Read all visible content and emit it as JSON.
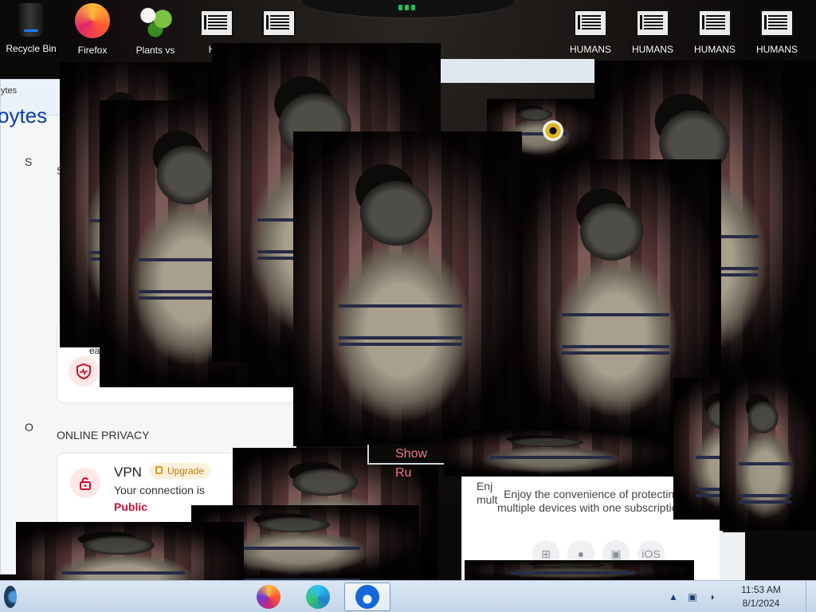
{
  "desktop": {
    "icons_left": [
      {
        "label": "Recycle Bin",
        "icon": "recycle-bin-icon"
      },
      {
        "label": "Firefox",
        "icon": "firefox-icon"
      },
      {
        "label": "Plants vs",
        "icon": "plants-vs-zombies-icon"
      },
      {
        "label": "HUI",
        "icon": "document-icon"
      },
      {
        "label": "",
        "icon": "document-icon"
      }
    ],
    "icons_right": [
      {
        "label": "HUMANS",
        "icon": "document-icon"
      },
      {
        "label": "HUMANS",
        "icon": "document-icon"
      },
      {
        "label": "HUMANS",
        "icon": "document-icon"
      },
      {
        "label": "HUMANS",
        "icon": "document-icon"
      }
    ]
  },
  "app": {
    "title_partial": "ytes",
    "brand_partial": "oytes",
    "side_letters": [
      "S",
      "S",
      "O"
    ],
    "online_privacy_label": "ONLINE PRIVACY",
    "vpn": {
      "title": "VPN",
      "upgrade_label": "Upgrade",
      "status_text": "Your connection is",
      "status_value": "Public"
    },
    "partial_text": "ea"
  },
  "popup": {
    "partial_text_line1": "Enj",
    "partial_text_line2": "mult",
    "text_line1": "Enjoy the convenience of protecting",
    "text_line2": "multiple devices with one subscription.",
    "platforms": [
      "windows-icon",
      "apple-icon",
      "android-icon",
      "iOS"
    ]
  },
  "show_run": "Show Ru",
  "taskbar": {
    "apps": [
      "firefox-icon",
      "edge-icon",
      "malwarebytes-icon"
    ],
    "time": "11:53 AM",
    "date": "8/1/2024"
  },
  "colors": {
    "accent": "#0d3ea8",
    "danger": "#c8102e",
    "upgrade": "#b07a12"
  }
}
